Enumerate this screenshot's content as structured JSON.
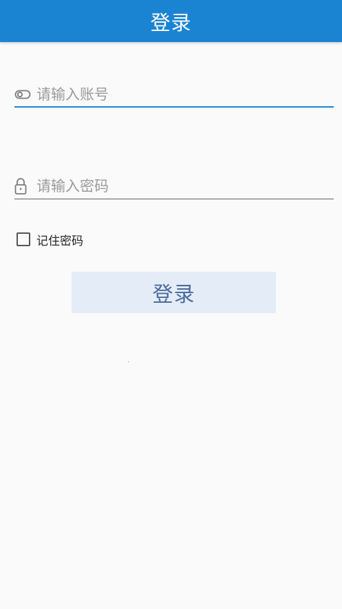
{
  "app_bar": {
    "title": "登录"
  },
  "form": {
    "account": {
      "placeholder": "请输入账号",
      "value": "",
      "icon": "toggle-icon"
    },
    "password": {
      "placeholder": "请输入密码",
      "value": "",
      "icon": "lock-icon"
    },
    "remember": {
      "label": "记住密码",
      "checked": false
    },
    "login_button_label": "登录"
  },
  "colors": {
    "primary": "#1b84d2",
    "background": "#fafafa",
    "button_bg": "#e4edf7",
    "button_text": "#4d6a9e"
  }
}
